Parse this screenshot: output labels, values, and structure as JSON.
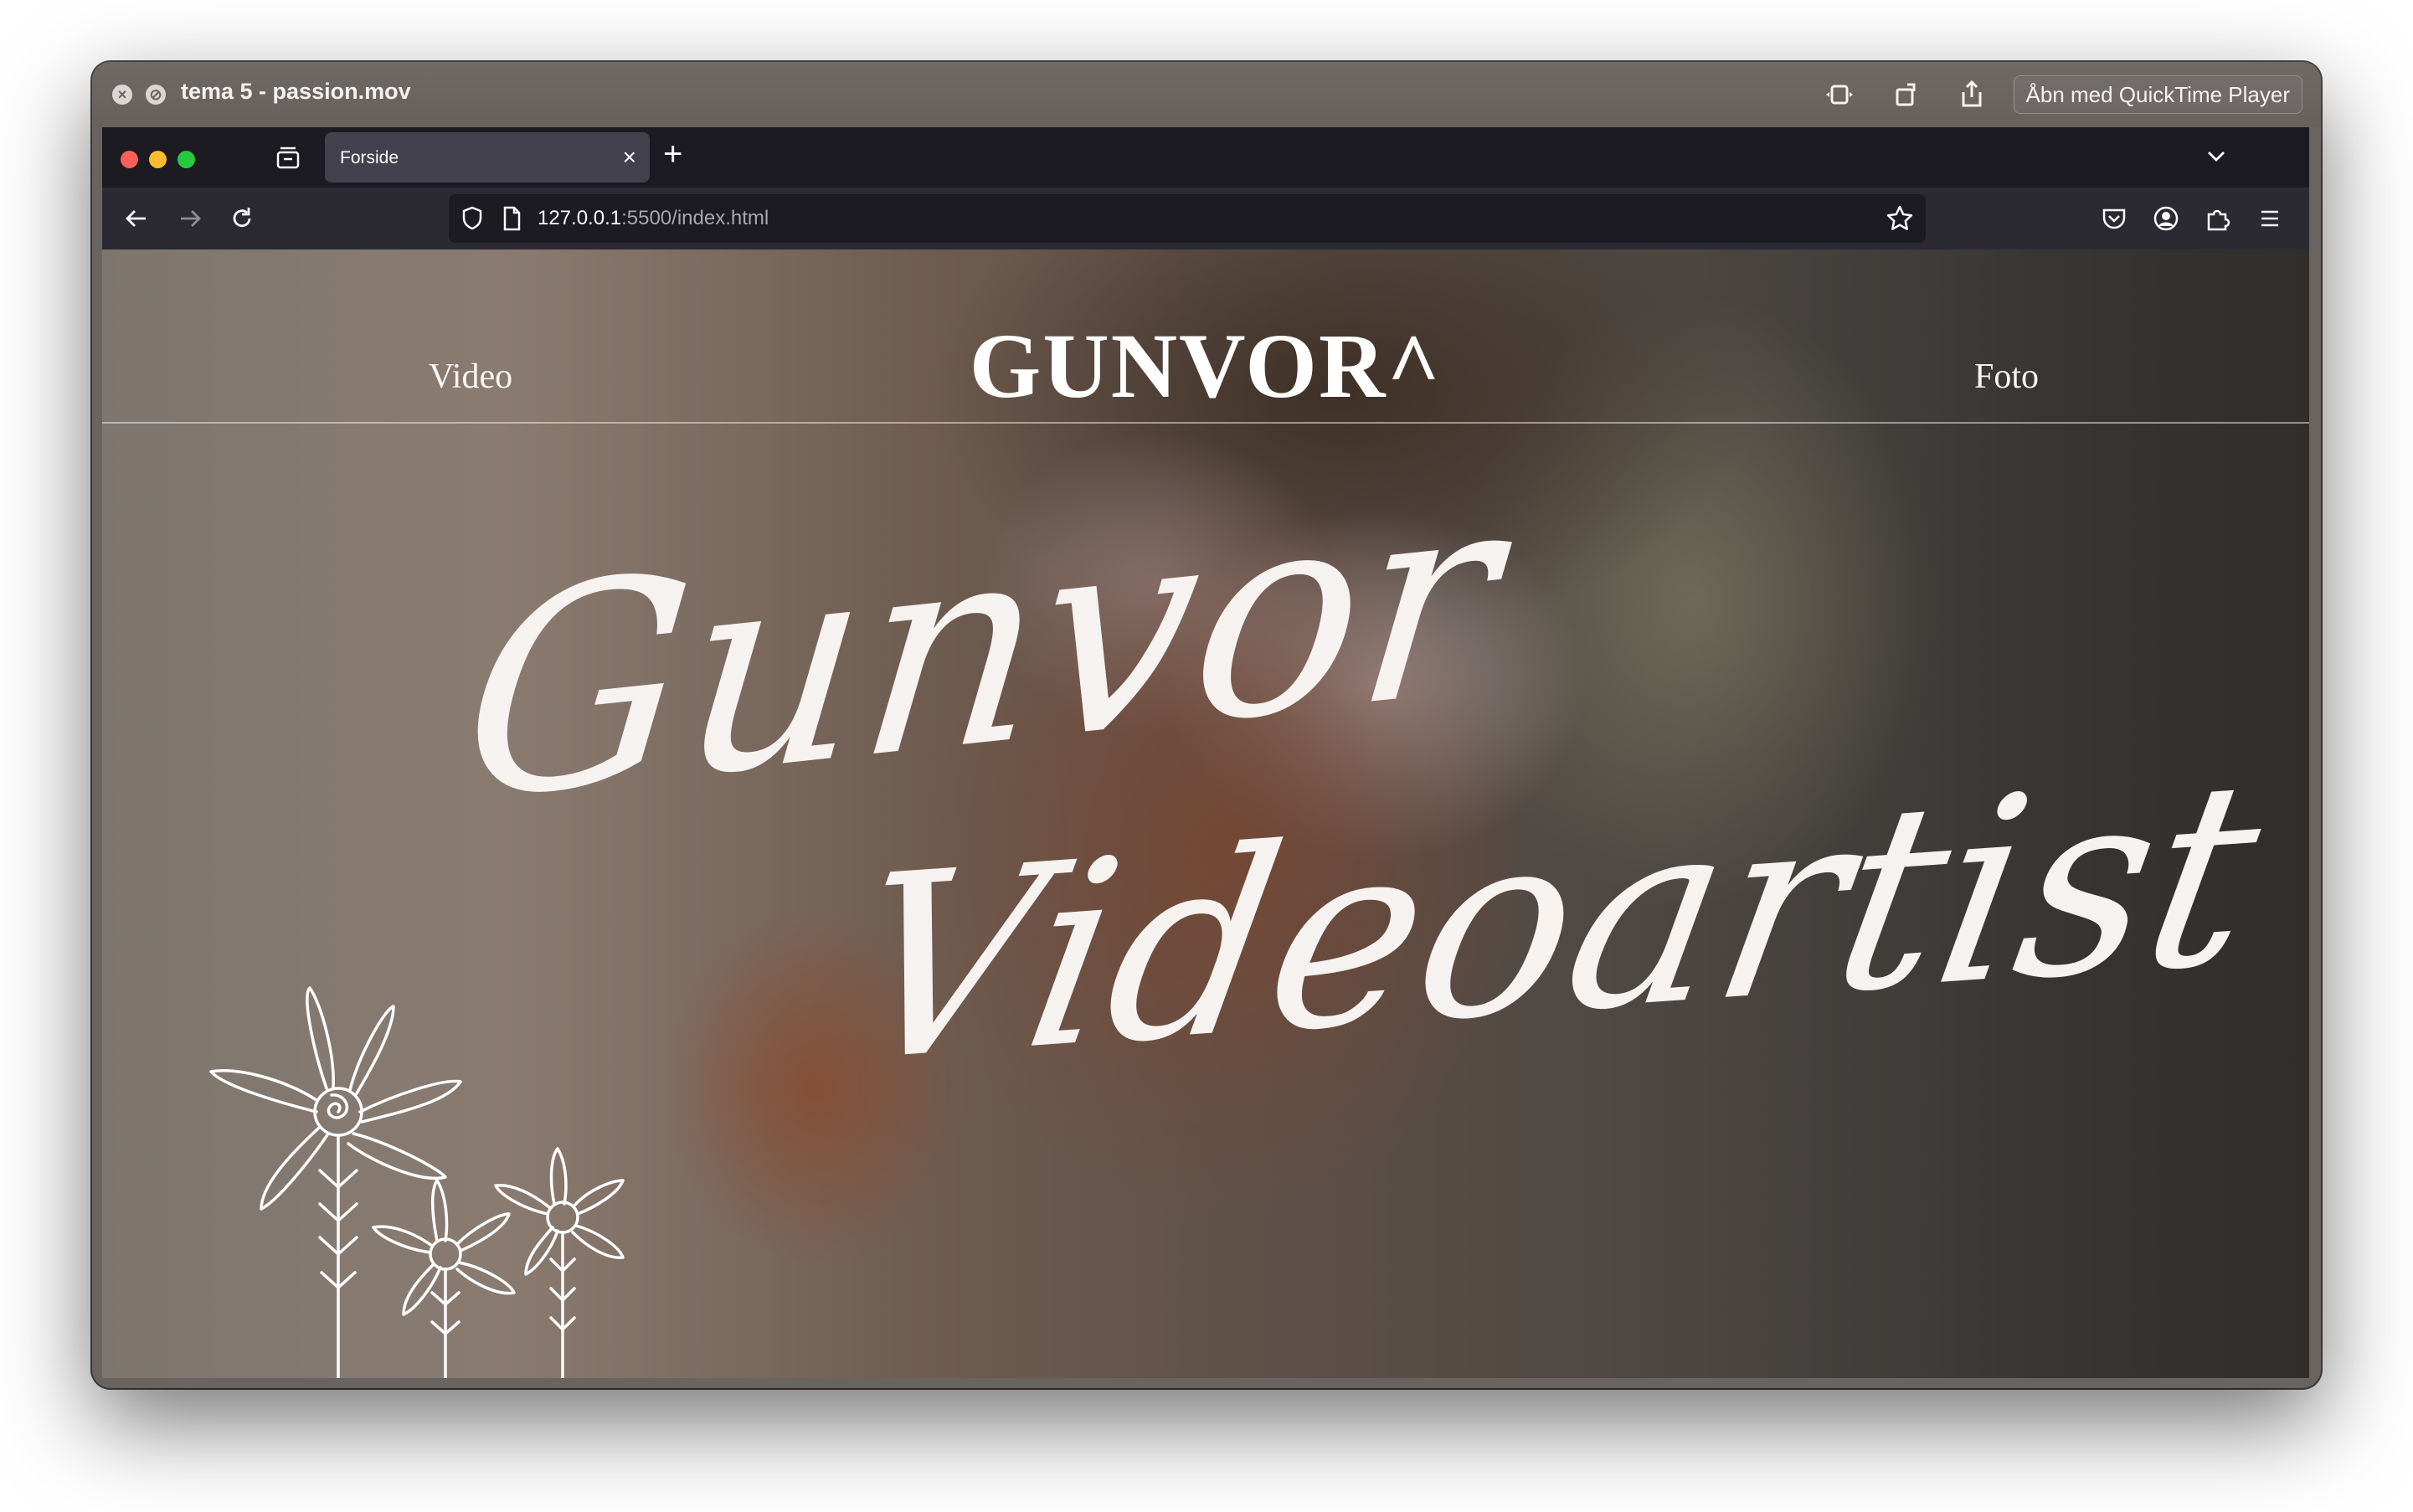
{
  "player": {
    "title": "tema 5 - passion.mov",
    "open_button": "Åbn med QuickTime Player"
  },
  "browser": {
    "tab_title": "Forside",
    "url_host": "127.0.0.1",
    "url_rest": ":5500/index.html"
  },
  "site": {
    "logo": "GUNVOR^",
    "nav_left": "Video",
    "nav_right": "Foto",
    "hero_line1": "Gunvor",
    "hero_line2": "Videoartist"
  },
  "colors": {
    "traffic_red": "#ff5f57",
    "traffic_yellow": "#febc2e",
    "traffic_green": "#28c840"
  }
}
